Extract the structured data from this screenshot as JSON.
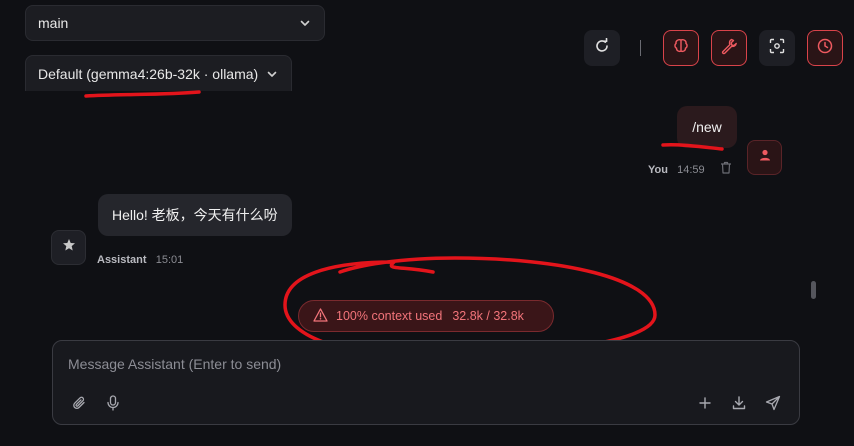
{
  "header": {
    "branch_select": "main",
    "model_select": "Default (gemma4:26b-32k · ollama)"
  },
  "toolbar": {
    "icons": [
      "refresh-icon",
      "brain-icon",
      "wrench-icon",
      "focus-scan-icon",
      "clock-icon"
    ],
    "accent_color": "#d9434a"
  },
  "messages": [
    {
      "role": "user",
      "text": "/new",
      "author": "You",
      "time": "14:59"
    },
    {
      "role": "assistant",
      "text": "Hello! 老板，今天有什么吩",
      "author": "Assistant",
      "time": "15:01"
    }
  ],
  "context_warning": {
    "label": "100% context used",
    "usage": "32.8k / 32.8k"
  },
  "composer": {
    "placeholder": "Message Assistant (Enter to send)"
  }
}
